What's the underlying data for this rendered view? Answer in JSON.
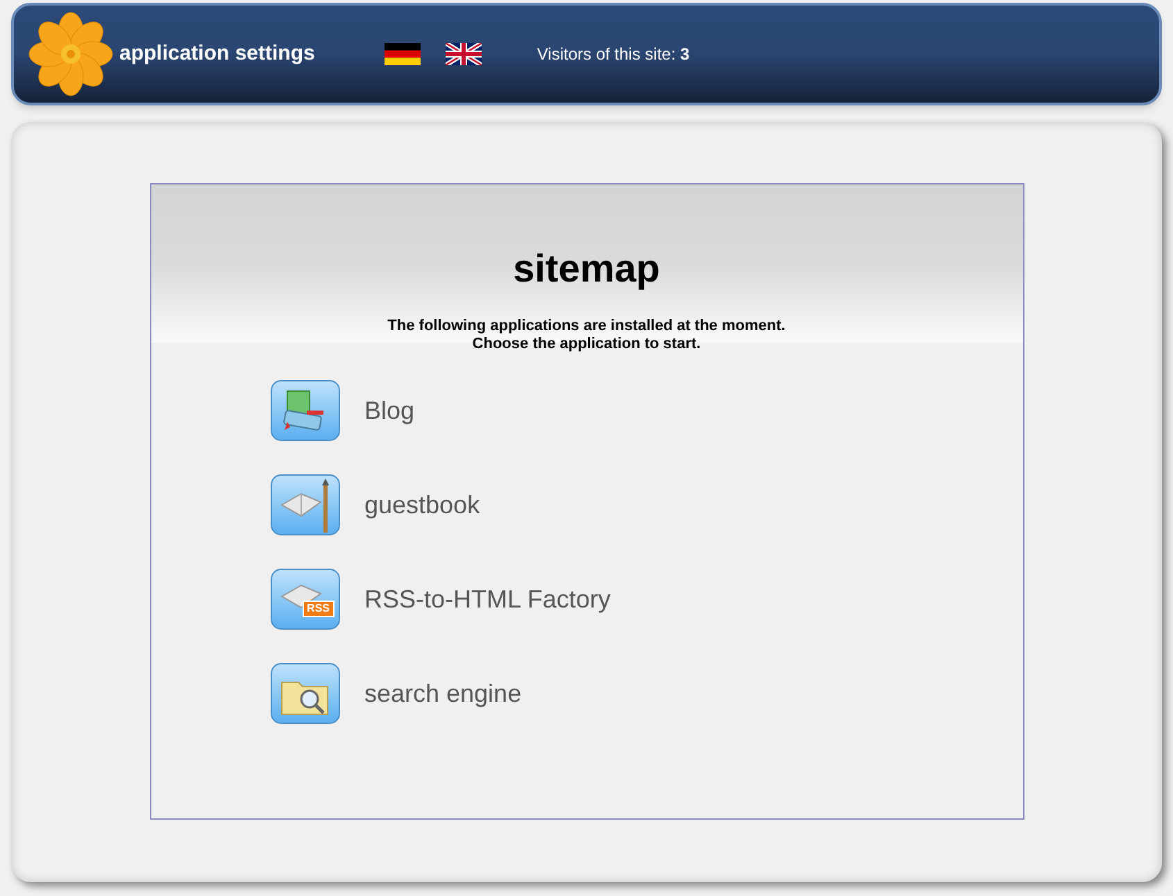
{
  "header": {
    "title": "application settings",
    "languages": [
      {
        "kind": "german"
      },
      {
        "kind": "english"
      }
    ],
    "visitors_label": "Visitors of this site:",
    "visitors_count": "3"
  },
  "sitemap": {
    "title": "sitemap",
    "intro_lines": [
      "The following applications are installed at the moment.",
      "Choose the application to start."
    ],
    "applications": [
      {
        "kind": "blog",
        "label": "Blog"
      },
      {
        "kind": "guestbook",
        "label": "guestbook"
      },
      {
        "kind": "rss",
        "label": "RSS-to-HTML Factory",
        "badge": "RSS"
      },
      {
        "kind": "search",
        "label": "search engine"
      }
    ]
  }
}
